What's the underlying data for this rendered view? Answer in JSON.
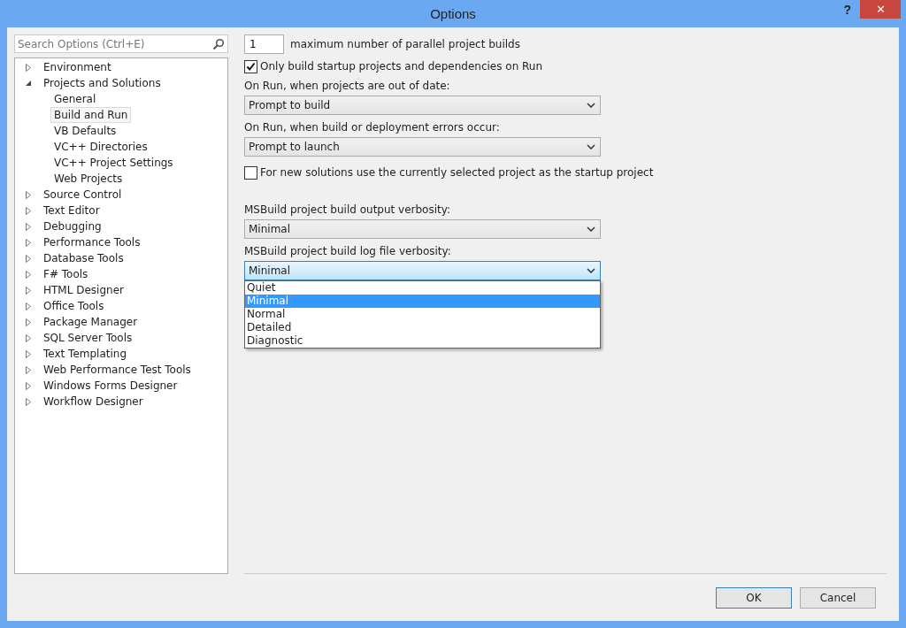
{
  "window": {
    "title": "Options",
    "help": "?",
    "close": "✕"
  },
  "search": {
    "placeholder": "Search Options (Ctrl+E)"
  },
  "tree": [
    {
      "label": "Environment",
      "expanded": false,
      "selected": false
    },
    {
      "label": "Projects and Solutions",
      "expanded": true,
      "selected": false,
      "children": [
        {
          "label": "General",
          "selected": false
        },
        {
          "label": "Build and Run",
          "selected": true
        },
        {
          "label": "VB Defaults",
          "selected": false
        },
        {
          "label": "VC++ Directories",
          "selected": false
        },
        {
          "label": "VC++ Project Settings",
          "selected": false
        },
        {
          "label": "Web Projects",
          "selected": false
        }
      ]
    },
    {
      "label": "Source Control",
      "expanded": false,
      "selected": false
    },
    {
      "label": "Text Editor",
      "expanded": false,
      "selected": false
    },
    {
      "label": "Debugging",
      "expanded": false,
      "selected": false
    },
    {
      "label": "Performance Tools",
      "expanded": false,
      "selected": false
    },
    {
      "label": "Database Tools",
      "expanded": false,
      "selected": false
    },
    {
      "label": "F# Tools",
      "expanded": false,
      "selected": false
    },
    {
      "label": "HTML Designer",
      "expanded": false,
      "selected": false
    },
    {
      "label": "Office Tools",
      "expanded": false,
      "selected": false
    },
    {
      "label": "Package Manager",
      "expanded": false,
      "selected": false
    },
    {
      "label": "SQL Server Tools",
      "expanded": false,
      "selected": false
    },
    {
      "label": "Text Templating",
      "expanded": false,
      "selected": false
    },
    {
      "label": "Web Performance Test Tools",
      "expanded": false,
      "selected": false
    },
    {
      "label": "Windows Forms Designer",
      "expanded": false,
      "selected": false
    },
    {
      "label": "Workflow Designer",
      "expanded": false,
      "selected": false
    }
  ],
  "parallel_builds": {
    "value": "1",
    "label": "maximum number of parallel project builds"
  },
  "only_build_startup": {
    "label": "Only build startup projects and dependencies on Run",
    "checked": true
  },
  "out_of_date": {
    "label": "On Run, when projects are out of date:",
    "value": "Prompt to build"
  },
  "build_errors": {
    "label": "On Run, when build or deployment errors occur:",
    "value": "Prompt to launch"
  },
  "new_solutions_startup": {
    "label": "For new solutions use the currently selected project as the startup project",
    "checked": false
  },
  "output_verbosity": {
    "label": "MSBuild project build output verbosity:",
    "value": "Minimal"
  },
  "log_verbosity": {
    "label": "MSBuild project build log file verbosity:",
    "value": "Minimal",
    "expanded": true,
    "options": [
      {
        "label": "Quiet",
        "selected": false
      },
      {
        "label": "Minimal",
        "selected": true
      },
      {
        "label": "Normal",
        "selected": false
      },
      {
        "label": "Detailed",
        "selected": false
      },
      {
        "label": "Diagnostic",
        "selected": false
      }
    ]
  },
  "buttons": [
    {
      "label": "OK",
      "default": true
    },
    {
      "label": "Cancel",
      "default": false
    }
  ]
}
